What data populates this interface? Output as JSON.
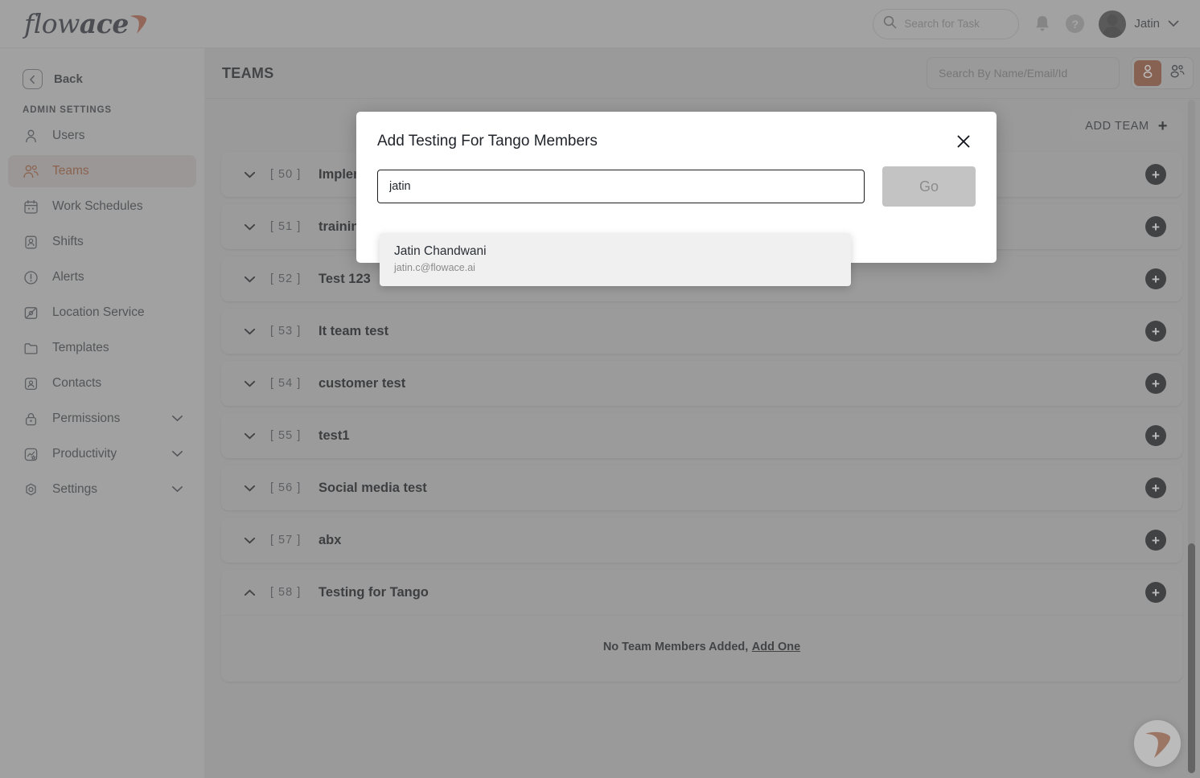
{
  "brand": {
    "name_light": "flow",
    "name_bold": "ace",
    "accent": "#e8562b",
    "logo_icon": "flowace-swoosh-icon"
  },
  "topbar": {
    "task_search_placeholder": "Search for Task",
    "search_icon": "search-icon",
    "bell_icon": "notification-bell-icon",
    "help_icon": "help-question-icon",
    "help_label": "?",
    "avatar_icon": "user-avatar",
    "user_name": "Jatin",
    "chevron_icon": "chevron-down-icon"
  },
  "sidebar": {
    "back_label": "Back",
    "back_icon": "chevron-left-icon",
    "section_label": "ADMIN SETTINGS",
    "items": [
      {
        "label": "Users",
        "icon": "user-icon",
        "active": false,
        "expandable": false
      },
      {
        "label": "Teams",
        "icon": "users-group-icon",
        "active": true,
        "expandable": false
      },
      {
        "label": "Work Schedules",
        "icon": "calendar-icon",
        "active": false,
        "expandable": false
      },
      {
        "label": "Shifts",
        "icon": "id-card-icon",
        "active": false,
        "expandable": false
      },
      {
        "label": "Alerts",
        "icon": "alert-circle-icon",
        "active": false,
        "expandable": false
      },
      {
        "label": "Location Service",
        "icon": "location-image-icon",
        "active": false,
        "expandable": false
      },
      {
        "label": "Templates",
        "icon": "folder-icon",
        "active": false,
        "expandable": false
      },
      {
        "label": "Contacts",
        "icon": "contact-card-icon",
        "active": false,
        "expandable": false
      },
      {
        "label": "Permissions",
        "icon": "lock-icon",
        "active": false,
        "expandable": true
      },
      {
        "label": "Productivity",
        "icon": "chart-star-icon",
        "active": false,
        "expandable": true
      },
      {
        "label": "Settings",
        "icon": "gear-icon",
        "active": false,
        "expandable": true
      }
    ]
  },
  "main": {
    "page_title": "TEAMS",
    "search_placeholder": "Search By Name/Email/Id",
    "view_toggle": [
      {
        "icon": "single-user-icon",
        "selected": true
      },
      {
        "icon": "users-group-icon",
        "selected": false
      }
    ],
    "add_team_label": "ADD TEAM",
    "add_team_icon": "plus-icon",
    "teams": [
      {
        "id": "[ 50 ]",
        "name": "Implem",
        "expanded": false
      },
      {
        "id": "[ 51 ]",
        "name": "training",
        "expanded": false
      },
      {
        "id": "[ 52 ]",
        "name": "Test 123",
        "expanded": false
      },
      {
        "id": "[ 53 ]",
        "name": "It team test",
        "expanded": false
      },
      {
        "id": "[ 54 ]",
        "name": "customer test",
        "expanded": false
      },
      {
        "id": "[ 55 ]",
        "name": "test1",
        "expanded": false
      },
      {
        "id": "[ 56 ]",
        "name": "Social media test",
        "expanded": false
      },
      {
        "id": "[ 57 ]",
        "name": "abx",
        "expanded": false
      },
      {
        "id": "[ 58 ]",
        "name": "Testing for Tango",
        "expanded": true
      }
    ],
    "empty_state_text": "No Team Members Added,",
    "empty_state_link": "Add One",
    "row_add_icon": "plus-circle-icon"
  },
  "modal": {
    "title": "Add Testing For Tango Members",
    "close_icon": "close-icon",
    "input_value": "jatin",
    "input_placeholder": "",
    "go_label": "Go",
    "suggestions": [
      {
        "name": "Jatin Chandwani",
        "email": "jatin.c@flowace.ai"
      }
    ]
  },
  "chat_widget": {
    "icon": "flowace-chat-icon"
  }
}
